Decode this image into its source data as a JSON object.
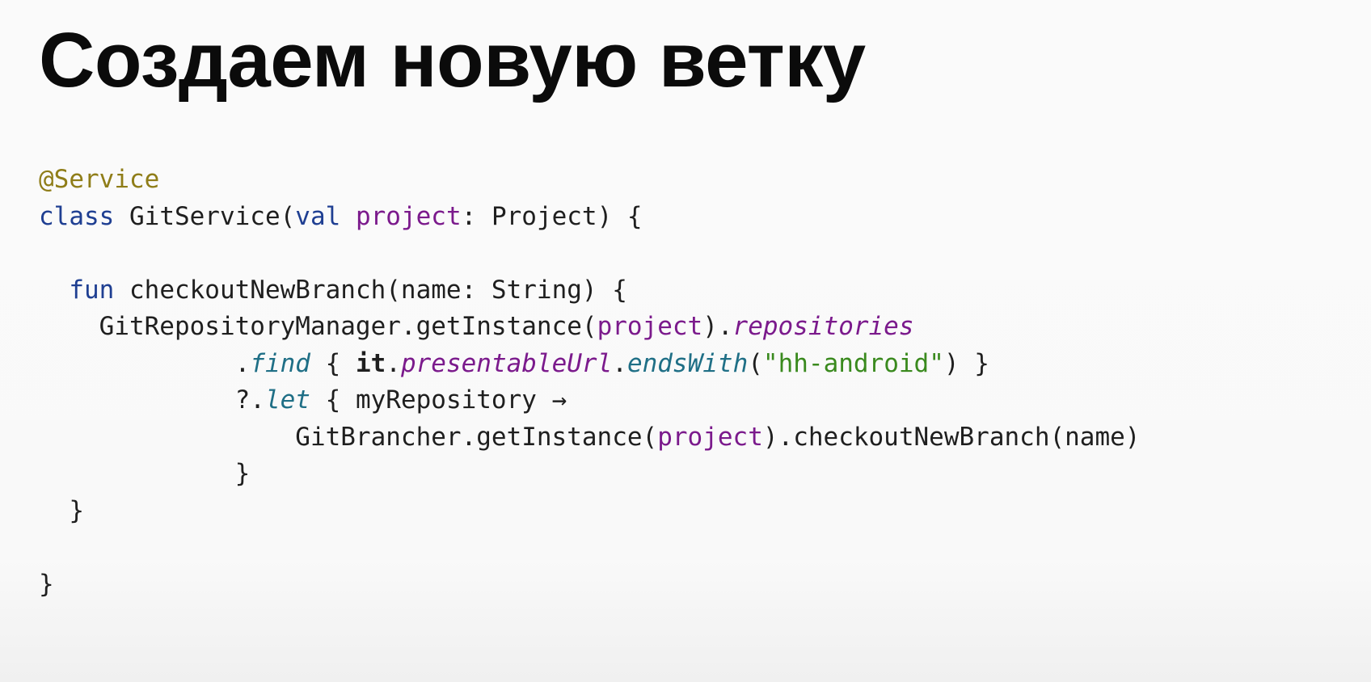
{
  "slide": {
    "title": "Создаем новую ветку"
  },
  "code": {
    "annotation": "@Service",
    "kw_class": "class",
    "class_name": " GitService(",
    "kw_val": "val",
    "param_project": "project",
    "ctor_rest": ": Project) {",
    "kw_fun": "fun",
    "fun_sig": " checkoutNewBranch(name: String) {",
    "manager_call": "GitRepositoryManager.getInstance(",
    "arg_project_1": "project",
    "close_paren_dot": ").",
    "prop_repositories": "repositories",
    "dot_1": ".",
    "ext_find": "find",
    "find_open": " { ",
    "it_kw": "it",
    "dot_2": ".",
    "prop_presentable": "presentableUrl",
    "dot_3": ".",
    "ext_endswith": "endsWith",
    "endswith_open": "(",
    "string_literal": "\"hh-android\"",
    "find_close": ") }",
    "safe_call": "?.",
    "ext_let": "let",
    "let_body": " { myRepository →",
    "brancher_call": "GitBrancher.getInstance(",
    "arg_project_2": "project",
    "brancher_rest": ").checkoutNewBranch(name)",
    "brace_let": "}",
    "brace_fun": "}",
    "brace_class": "}"
  }
}
